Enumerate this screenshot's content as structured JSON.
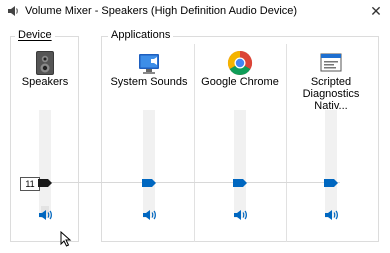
{
  "window": {
    "title": "Volume Mixer - Speakers (High Definition Audio Device)",
    "close_glyph": "✕"
  },
  "device_group": {
    "title": "Device"
  },
  "apps_group": {
    "title": "Applications"
  },
  "channels": [
    {
      "label": "Speakers",
      "icon": "speaker-device-icon",
      "level_text": "11"
    },
    {
      "label": "System Sounds",
      "icon": "system-sounds-icon"
    },
    {
      "label": "Google Chrome",
      "icon": "chrome-icon"
    },
    {
      "label": "Scripted Diagnostics Nativ...",
      "icon": "scripted-diagnostics-icon"
    }
  ],
  "colors": {
    "accent": "#0067c0",
    "track": "#f1f1f1",
    "border": "#dcdcdc"
  }
}
